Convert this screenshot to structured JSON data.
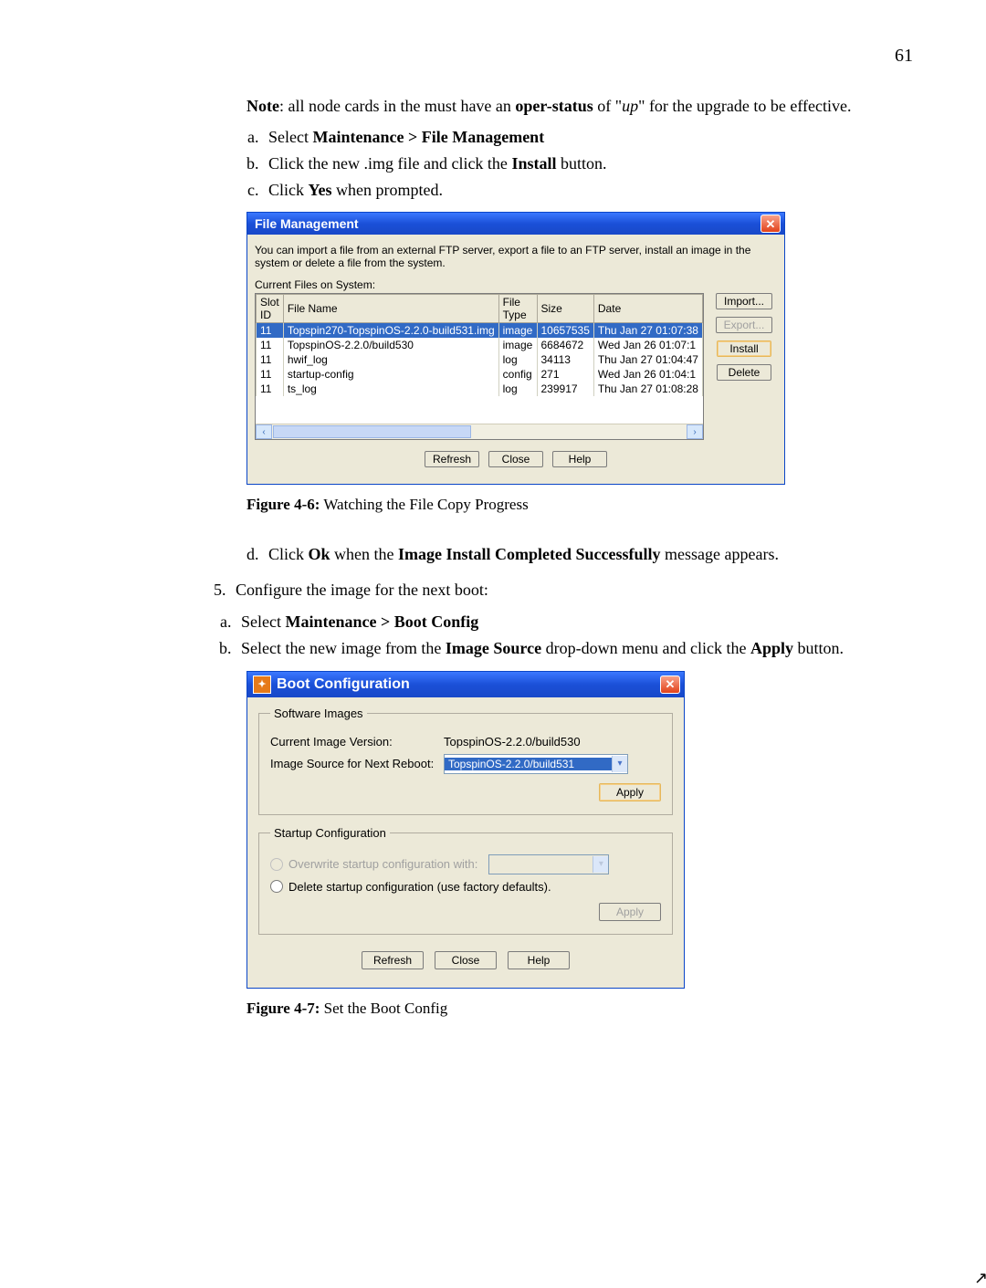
{
  "page_number": "61",
  "note_prefix": "Note",
  "note_text": ": all node cards in the must have an ",
  "note_bold1": "oper-status",
  "note_text2": " of \"",
  "note_italic": "up",
  "note_text3": "\" for the upgrade to be effective.",
  "steps1": {
    "a_pre": "Select ",
    "a_bold": "Maintenance > File Management",
    "b_pre": "Click the new .img file and click the ",
    "b_bold": "Install",
    "b_post": " button.",
    "c_pre": "Click ",
    "c_bold": "Yes",
    "c_post": " when prompted."
  },
  "fm": {
    "title": "File Management",
    "desc": "You can import a file from an external FTP server, export a file to an FTP server, install an image in the system or delete a file from the system.",
    "current_label": "Current Files on System:",
    "headers": {
      "slot": "Slot ID",
      "name": "File Name",
      "type": "File Type",
      "size": "Size",
      "date": "Date"
    },
    "rows": [
      {
        "slot": "11",
        "name": "Topspin270-TopspinOS-2.2.0-build531.img",
        "type": "image",
        "size": "10657535",
        "date": "Thu Jan 27 01:07:38",
        "selected": true
      },
      {
        "slot": "11",
        "name": "TopspinOS-2.2.0/build530",
        "type": "image",
        "size": "6684672",
        "date": "Wed Jan 26 01:07:1"
      },
      {
        "slot": "11",
        "name": "hwif_log",
        "type": "log",
        "size": "34113",
        "date": "Thu Jan 27 01:04:47"
      },
      {
        "slot": "11",
        "name": "startup-config",
        "type": "config",
        "size": "271",
        "date": "Wed Jan 26 01:04:1"
      },
      {
        "slot": "11",
        "name": "ts_log",
        "type": "log",
        "size": "239917",
        "date": "Thu Jan 27 01:08:28"
      }
    ],
    "buttons": {
      "import": "Import...",
      "export": "Export...",
      "install": "Install",
      "delete": "Delete",
      "refresh": "Refresh",
      "close": "Close",
      "help": "Help"
    }
  },
  "caption1_a": "Figure 4-6:",
  "caption1_b": " Watching the File Copy Progress",
  "mid_d_pre": "Click ",
  "mid_d_bold1": "Ok",
  "mid_d_mid": " when the ",
  "mid_d_bold2": "Image Install Completed Successfully",
  "mid_d_post": " message appears.",
  "step5": "Configure the image for the next boot:",
  "steps2": {
    "a_pre": "Select ",
    "a_bold": "Maintenance > Boot Config",
    "b_pre": "Select the new image from the ",
    "b_bold1": "Image Source",
    "b_mid": " drop-down menu and click the ",
    "b_bold2": "Apply",
    "b_post": " button."
  },
  "bc": {
    "title": "Boot Configuration",
    "group1": "Software Images",
    "current_lbl": "Current Image Version:",
    "current_val": "TopspinOS-2.2.0/build530",
    "source_lbl": "Image Source for Next Reboot:",
    "source_val": "TopspinOS-2.2.0/build531",
    "apply": "Apply",
    "group2": "Startup Configuration",
    "radio1": "Overwrite startup configuration with:",
    "radio2": "Delete startup configuration (use factory defaults).",
    "refresh": "Refresh",
    "close": "Close",
    "help": "Help"
  },
  "caption2_a": "Figure 4-7:",
  "caption2_b": " Set the Boot Config"
}
